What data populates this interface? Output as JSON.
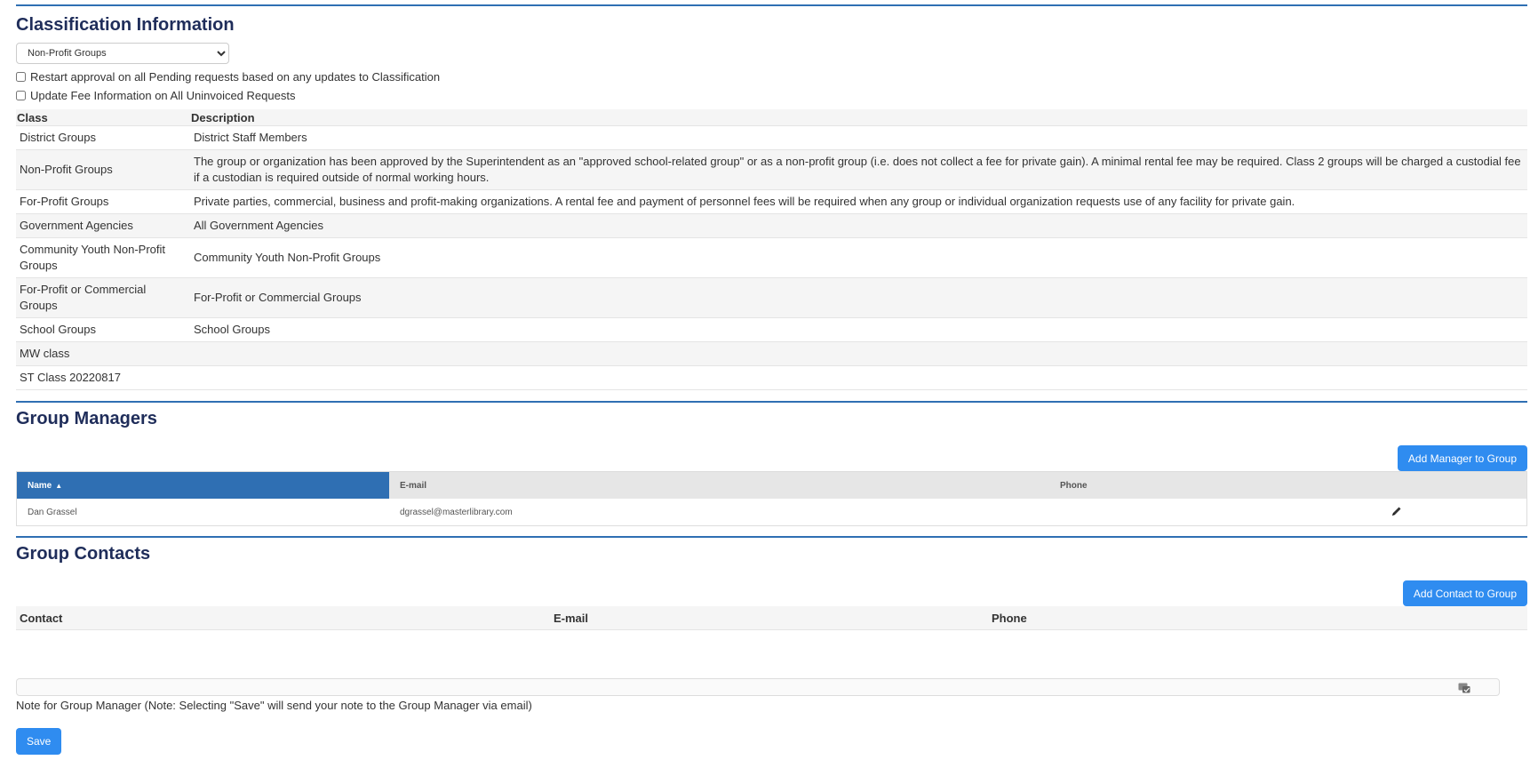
{
  "classification": {
    "title": "Classification Information",
    "selected_class": "Non-Profit Groups",
    "restart_approval_label": "Restart approval on all Pending requests based on any updates to Classification",
    "update_fee_label": "Update Fee Information on All Uninvoiced Requests",
    "table": {
      "headers": [
        "Class",
        "Description"
      ],
      "rows": [
        {
          "class": "District Groups",
          "description": "District Staff Members"
        },
        {
          "class": "Non-Profit Groups",
          "description": "The group or organization has been approved by the Superintendent as an \"approved school-related group\" or as a non-profit group (i.e. does not collect a fee for private gain). A minimal rental fee may be required. Class 2 groups will be charged a custodial fee if a custodian is required outside of normal working hours."
        },
        {
          "class": "For-Profit Groups",
          "description": "Private parties, commercial, business and profit-making organizations. A rental fee and payment of personnel fees will be required when any group or individual organization requests use of any facility for private gain."
        },
        {
          "class": "Government Agencies",
          "description": "All Government Agencies"
        },
        {
          "class": "Community Youth Non-Profit Groups",
          "description": "Community Youth Non-Profit Groups"
        },
        {
          "class": "For-Profit or Commercial Groups",
          "description": "For-Profit or Commercial Groups"
        },
        {
          "class": "School Groups",
          "description": "School Groups"
        },
        {
          "class": "MW class",
          "description": ""
        },
        {
          "class": "ST Class 20220817",
          "description": ""
        }
      ]
    }
  },
  "managers": {
    "title": "Group Managers",
    "add_button": "Add Manager to Group",
    "headers": {
      "name": "Name",
      "email": "E-mail",
      "phone": "Phone"
    },
    "sort_indicator": "▲",
    "rows": [
      {
        "name": "Dan Grassel",
        "email": "dgrassel@masterlibrary.com",
        "phone": ""
      }
    ]
  },
  "contacts": {
    "title": "Group Contacts",
    "add_button": "Add Contact to Group",
    "headers": {
      "contact": "Contact",
      "email": "E-mail",
      "phone": "Phone"
    }
  },
  "note": {
    "value": "",
    "label": "Note for Group Manager (Note: Selecting \"Save\" will send your note to the Group Manager via email)"
  },
  "save_button": "Save",
  "colors": {
    "accent": "#2f8cf0",
    "section_rule": "#2f6fb3",
    "heading": "#1f2d5a"
  },
  "icons": {
    "edit": "pencil-icon",
    "note": "spellcheck-icon"
  }
}
